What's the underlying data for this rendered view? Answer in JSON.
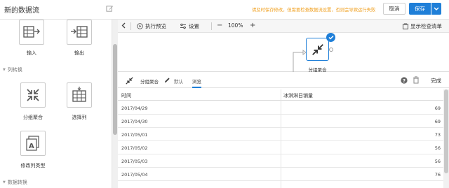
{
  "header": {
    "title": "新的数据流",
    "notice": "请及时保存修改，但需要检查数据流设置，否则会导致运行失败",
    "cancel_label": "取消",
    "save_label": "保存"
  },
  "left_panel": {
    "tools": [
      {
        "label": "输入",
        "icon": "table-input-icon"
      },
      {
        "label": "输出",
        "icon": "table-output-icon"
      },
      {
        "label": "分组聚合",
        "icon": "collapse-arrows-icon"
      },
      {
        "label": "选择列",
        "icon": "select-column-icon"
      },
      {
        "label": "修改列类型",
        "icon": "change-type-icon"
      }
    ],
    "sections": [
      "列转换",
      "数据转换"
    ]
  },
  "toolbar": {
    "preview_label": "执行预览",
    "settings_label": "设置",
    "zoom": "100%",
    "checklist_label": "显示检查清单"
  },
  "canvas": {
    "node_label": "分组聚合"
  },
  "detail": {
    "node_name": "分组聚合",
    "rename_label": "默认",
    "tab_label": "浏览",
    "done_label": "完成"
  },
  "table": {
    "columns": [
      "时间",
      "冰淇淋日销量"
    ],
    "rows": [
      [
        "2017/04/29",
        "69"
      ],
      [
        "2017/04/30",
        "69"
      ],
      [
        "2017/05/01",
        "73"
      ],
      [
        "2017/05/02",
        "56"
      ],
      [
        "2017/05/03",
        "56"
      ],
      [
        "2017/05/04",
        "76"
      ]
    ]
  },
  "colors": {
    "accent": "#1f7fd8",
    "notice": "#f0a020"
  }
}
